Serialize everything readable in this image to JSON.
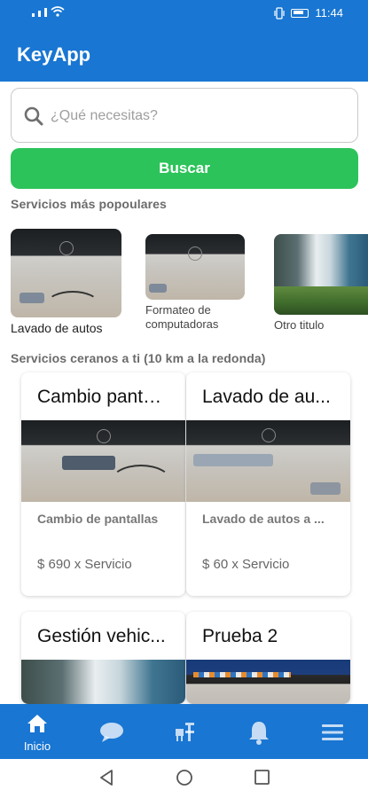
{
  "status_bar": {
    "time": "11:44"
  },
  "app_bar": {
    "title": "KeyApp"
  },
  "search": {
    "placeholder": "¿Qué necesitas?",
    "button_label": "Buscar"
  },
  "popular": {
    "title": "Servicios más popoulares",
    "items": [
      {
        "label": "Lavado de autos",
        "image": "laptop-photo"
      },
      {
        "label": "Formateo de computadoras",
        "image": "laptop-photo"
      },
      {
        "label": "Otro titulo",
        "image": "waterfall-photo"
      }
    ]
  },
  "nearby": {
    "title": "Servicios ceranos a ti (10 km a la redonda)",
    "cards": [
      {
        "title": "Cambio pantalla...",
        "description": "Cambio de pantallas",
        "price": "$ 690 x Servicio",
        "image": "laptop-photo"
      },
      {
        "title": "Lavado de au...",
        "description": "Lavado de autos a ...",
        "price": "$ 60 x Servicio",
        "image": "laptop-photo"
      },
      {
        "title": "Gestión vehic...",
        "description": "",
        "price": "",
        "image": "waterfall-photo"
      },
      {
        "title": "Prueba 2",
        "description": "",
        "price": "",
        "image": "screen-photo"
      }
    ]
  },
  "bottom_nav": {
    "items": [
      {
        "label": "Inicio",
        "icon": "home-icon",
        "active": true
      },
      {
        "label": "",
        "icon": "chat-icon",
        "active": false
      },
      {
        "label": "",
        "icon": "services-icon",
        "active": false
      },
      {
        "label": "",
        "icon": "bell-icon",
        "active": false
      },
      {
        "label": "",
        "icon": "menu-icon",
        "active": false
      }
    ]
  },
  "colors": {
    "primary": "#1976d2",
    "accent_green": "#2cc35a"
  }
}
